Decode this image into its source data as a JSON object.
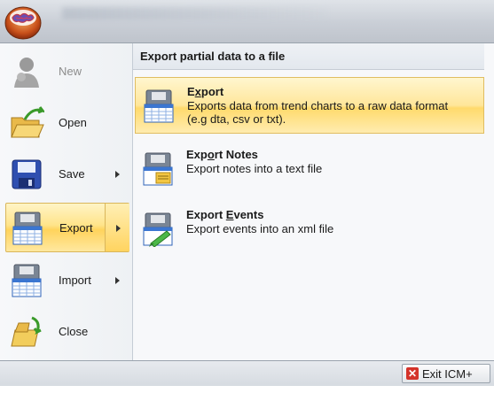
{
  "left_menu": {
    "items": [
      {
        "label": "New",
        "icon": "new-user-icon",
        "state": "disabled"
      },
      {
        "label": "Open",
        "icon": "open-folder-icon"
      },
      {
        "label": "Save",
        "icon": "save-disk-icon",
        "has_submenu": true
      },
      {
        "label": "Export",
        "icon": "export-icon",
        "has_submenu": true,
        "state": "selected"
      },
      {
        "label": "Import",
        "icon": "import-icon",
        "has_submenu": true
      },
      {
        "label": "Close",
        "icon": "close-folder-icon"
      }
    ]
  },
  "submenu": {
    "header": "Export partial data to a file",
    "items": [
      {
        "title_pre": "E",
        "title_u": "x",
        "title_post": "port",
        "description": "Exports data from trend charts to a raw data format (e.g dta, csv or txt).",
        "icon": "export-data-icon",
        "state": "selected"
      },
      {
        "title_pre": "Exp",
        "title_u": "o",
        "title_post": "rt Notes",
        "description": "Export notes into a text file",
        "icon": "export-notes-icon"
      },
      {
        "title_pre": "Export ",
        "title_u": "E",
        "title_post": "vents",
        "description": "Export events into an xml file",
        "icon": "export-events-icon"
      }
    ]
  },
  "footer": {
    "exit_label": "Exit ICM+",
    "exit_icon": "exit-x-icon"
  },
  "colors": {
    "highlight_top": "#fff4c6",
    "highlight_mid": "#ffd35c",
    "highlight_border": "#d9b65b",
    "exit_red": "#d4332a"
  }
}
